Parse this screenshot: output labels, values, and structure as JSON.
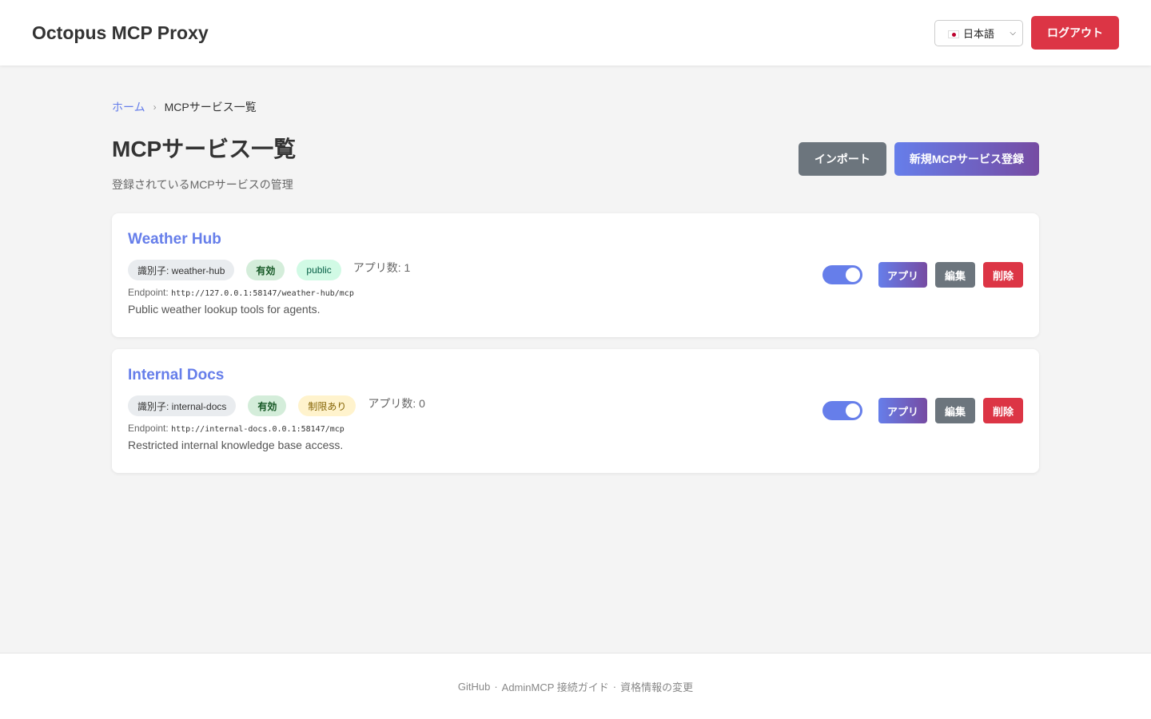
{
  "header": {
    "app_title": "Octopus MCP Proxy",
    "language_selected": "日本語",
    "logout_label": "ログアウト"
  },
  "breadcrumb": {
    "home": "ホーム",
    "separator": "›",
    "current": "MCPサービス一覧"
  },
  "page": {
    "title": "MCPサービス一覧",
    "subtitle": "登録されているMCPサービスの管理",
    "import_label": "インポート",
    "new_service_label": "新規MCPサービス登録"
  },
  "services": [
    {
      "name": "Weather Hub",
      "identifier": "識別子: weather-hub",
      "status": "有効",
      "access": "public",
      "app_count": "アプリ数: 1",
      "endpoint_label": "Endpoint:",
      "endpoint_url": "http://127.0.0.1:58147/weather-hub/mcp",
      "description": "Public weather lookup tools for agents.",
      "enabled": true,
      "apps_label": "アプリ",
      "edit_label": "編集",
      "delete_label": "削除"
    },
    {
      "name": "Internal Docs",
      "identifier": "識別子: internal-docs",
      "status": "有効",
      "access": "制限あり",
      "app_count": "アプリ数: 0",
      "endpoint_label": "Endpoint:",
      "endpoint_url": "http://internal-docs.0.0.1:58147/mcp",
      "description": "Restricted internal knowledge base access.",
      "enabled": true,
      "apps_label": "アプリ",
      "edit_label": "編集",
      "delete_label": "削除"
    }
  ],
  "footer": {
    "github": "GitHub",
    "separator": "·",
    "admin_guide": "AdminMCP 接続ガイド",
    "credentials": "資格情報の変更"
  },
  "colors": {
    "accent": "#667eea",
    "accent_end": "#764ba2",
    "danger": "#dc3545",
    "secondary": "#6c757d"
  }
}
